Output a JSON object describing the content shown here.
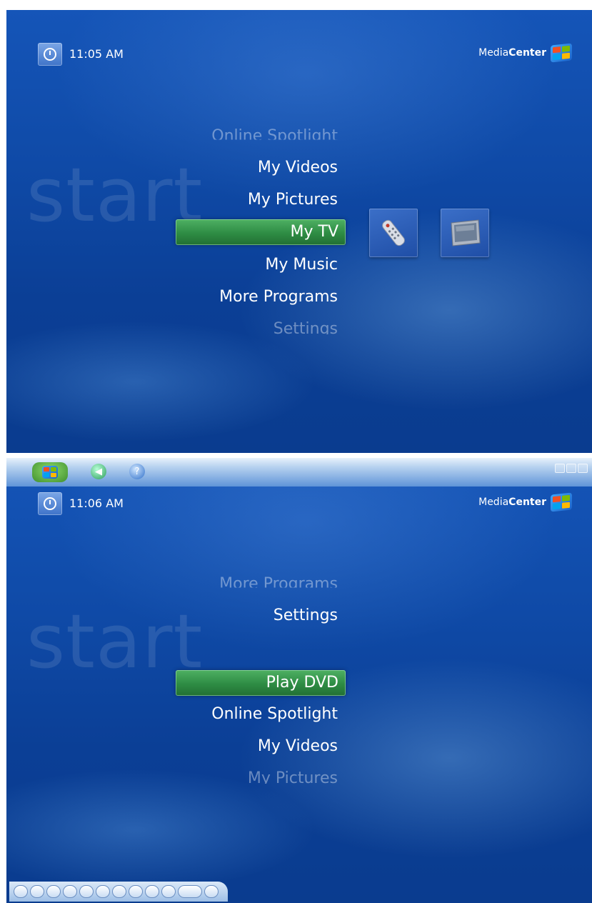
{
  "screens": [
    {
      "clock": "11:05 AM",
      "brand": {
        "light": "Media",
        "bold": "Center"
      },
      "watermark": "start",
      "menu": {
        "above": [
          "Online Spotlight",
          "My Videos",
          "My Pictures"
        ],
        "selected": "My TV",
        "below": [
          "My Music",
          "More Programs",
          "Settings"
        ]
      },
      "tiles": [
        {
          "icon": "remote-control-icon"
        },
        {
          "icon": "tv-monitor-icon"
        }
      ]
    },
    {
      "clock": "11:06 AM",
      "brand": {
        "light": "Media",
        "bold": "Center"
      },
      "watermark": "start",
      "menu": {
        "above": [
          "More Programs",
          "Settings"
        ],
        "selected": "Play DVD",
        "below": [
          "Online Spotlight",
          "My Videos",
          "My Pictures"
        ]
      },
      "titlebar": {
        "buttons": [
          "windows-start-icon",
          "back-arrow-icon",
          "help-icon"
        ],
        "window_controls": [
          "minimize-icon",
          "maximize-icon",
          "close-icon"
        ]
      },
      "transport": {
        "buttons": [
          "mute-icon",
          "volume-down-icon",
          "volume-up-icon",
          "stop-icon",
          "play-icon",
          "pause-icon",
          "rewind-icon",
          "fast-forward-icon",
          "skip-back-icon",
          "skip-forward-icon",
          "record-icon",
          "channel-down-icon",
          "channel-up-icon"
        ]
      }
    }
  ],
  "colors": {
    "background": "#0f4aa7",
    "selection": "#2e8c44",
    "text": "#ffffff"
  }
}
